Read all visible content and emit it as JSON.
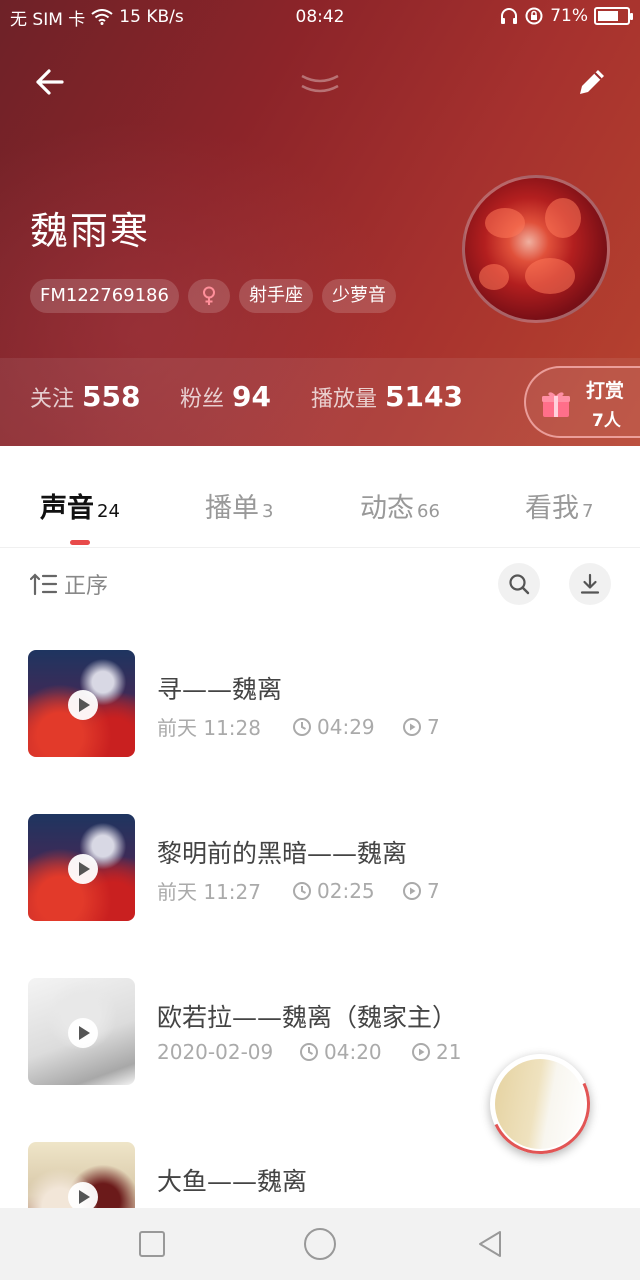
{
  "status_bar": {
    "carrier": "无 SIM 卡",
    "network_speed": "15 KB/s",
    "time": "08:42",
    "battery_percent": "71%",
    "battery_level": 0.71
  },
  "profile": {
    "name": "魏雨寒",
    "tags": [
      "FM122769186",
      "射手座",
      "少萝音"
    ],
    "gender_icon": "female-icon"
  },
  "stats": [
    {
      "label": "关注",
      "value": "558"
    },
    {
      "label": "粉丝",
      "value": "94"
    },
    {
      "label": "播放量",
      "value": "5143"
    }
  ],
  "reward": {
    "label": "打赏",
    "count": "7人"
  },
  "tabs": [
    {
      "label": "声音",
      "count": "24",
      "active": true
    },
    {
      "label": "播单",
      "count": "3",
      "active": false
    },
    {
      "label": "动态",
      "count": "66",
      "active": false
    },
    {
      "label": "看我",
      "count": "7",
      "active": false
    }
  ],
  "toolbar": {
    "sort_label": "正序"
  },
  "tracks": [
    {
      "title": "寻——魏离",
      "date": "前天 11:28",
      "duration": "04:29",
      "plays": "7"
    },
    {
      "title": "黎明前的黑暗——魏离",
      "date": "前天 11:27",
      "duration": "02:25",
      "plays": "7"
    },
    {
      "title": "欧若拉——魏离（魏家主）",
      "date": "2020-02-09",
      "duration": "04:20",
      "plays": "21"
    },
    {
      "title": "大鱼——魏离",
      "date": "",
      "duration": "",
      "plays": ""
    }
  ],
  "colors": {
    "accent": "#e84a4a",
    "header_start": "#6e2228",
    "header_end": "#b7432f"
  }
}
